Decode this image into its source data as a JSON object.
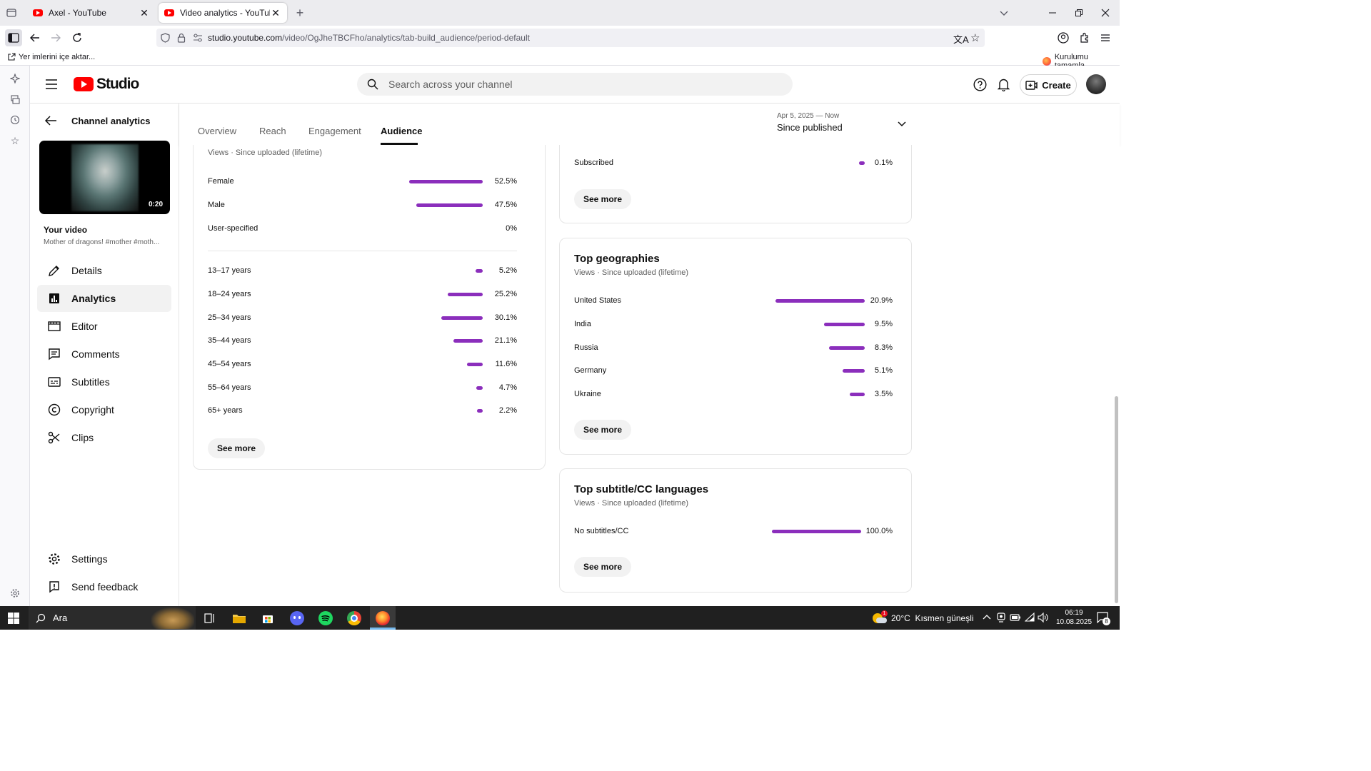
{
  "browser": {
    "tabs": [
      {
        "title": "Axel - YouTube",
        "favicon": "youtube-favicon"
      },
      {
        "title": "Video analytics - YouTube Studi",
        "favicon": "youtube-favicon"
      }
    ],
    "url_domain": "studio.youtube.com",
    "url_path": "/video/OgJheTBCFho/analytics/tab-build_audience/period-default",
    "bookmarks_import": "Yer imlerini içe aktar...",
    "setup_text": "Kurulumu tamamla"
  },
  "header": {
    "logo_text": "Studio",
    "search_placeholder": "Search across your channel",
    "create_label": "Create"
  },
  "sidebar": {
    "back_title": "Channel analytics",
    "video_duration": "0:20",
    "your_video": "Your video",
    "video_title": "Mother of dragons! #mother #moth...",
    "items": [
      {
        "label": "Details",
        "icon": "pencil-icon"
      },
      {
        "label": "Analytics",
        "icon": "analytics-icon"
      },
      {
        "label": "Editor",
        "icon": "editor-icon"
      },
      {
        "label": "Comments",
        "icon": "comments-icon"
      },
      {
        "label": "Subtitles",
        "icon": "subtitles-icon"
      },
      {
        "label": "Copyright",
        "icon": "copyright-icon"
      },
      {
        "label": "Clips",
        "icon": "scissors-icon"
      }
    ],
    "bottom_items": [
      {
        "label": "Settings",
        "icon": "gear-icon"
      },
      {
        "label": "Send feedback",
        "icon": "feedback-icon"
      }
    ]
  },
  "tabs": [
    "Overview",
    "Reach",
    "Engagement",
    "Audience"
  ],
  "active_tab": "Audience",
  "period": {
    "range": "Apr 5, 2025 — Now",
    "label": "Since published"
  },
  "demographics": {
    "subtitle": "Views · Since uploaded (lifetime)",
    "gender": [
      {
        "label": "Female",
        "value": "52.5%",
        "pct": 52.5
      },
      {
        "label": "Male",
        "value": "47.5%",
        "pct": 47.5
      },
      {
        "label": "User-specified",
        "value": "0%",
        "pct": 0
      }
    ],
    "age": [
      {
        "label": "13–17 years",
        "value": "5.2%",
        "pct": 5.2
      },
      {
        "label": "18–24 years",
        "value": "25.2%",
        "pct": 25.2
      },
      {
        "label": "25–34 years",
        "value": "30.1%",
        "pct": 30.1
      },
      {
        "label": "35–44 years",
        "value": "21.1%",
        "pct": 21.1
      },
      {
        "label": "45–54 years",
        "value": "11.6%",
        "pct": 11.6
      },
      {
        "label": "55–64 years",
        "value": "4.7%",
        "pct": 4.7
      },
      {
        "label": "65+ years",
        "value": "2.2%",
        "pct": 2.2
      }
    ],
    "see_more": "See more"
  },
  "subscription": {
    "rows": [
      {
        "label": "Subscribed",
        "value": "0.1%",
        "pct": 0.1
      }
    ],
    "see_more": "See more"
  },
  "geographies": {
    "title": "Top geographies",
    "subtitle": "Views · Since uploaded (lifetime)",
    "rows": [
      {
        "label": "United States",
        "value": "20.9%",
        "pct": 20.9
      },
      {
        "label": "India",
        "value": "9.5%",
        "pct": 9.5
      },
      {
        "label": "Russia",
        "value": "8.3%",
        "pct": 8.3
      },
      {
        "label": "Germany",
        "value": "5.1%",
        "pct": 5.1
      },
      {
        "label": "Ukraine",
        "value": "3.5%",
        "pct": 3.5
      }
    ],
    "see_more": "See more"
  },
  "subtitles_card": {
    "title": "Top subtitle/CC languages",
    "subtitle": "Views · Since uploaded (lifetime)",
    "rows": [
      {
        "label": "No subtitles/CC",
        "value": "100.0%",
        "pct": 100
      }
    ],
    "see_more": "See more"
  },
  "taskbar": {
    "search_text": "Ara",
    "weather": "20°C  Kısmen güneşli",
    "time": "06:19",
    "date": "10.08.2025",
    "notification_count": "8",
    "weather_badge": "1"
  },
  "colors": {
    "accent_bar": "#8b2ebc",
    "youtube_red": "#ff0000"
  }
}
